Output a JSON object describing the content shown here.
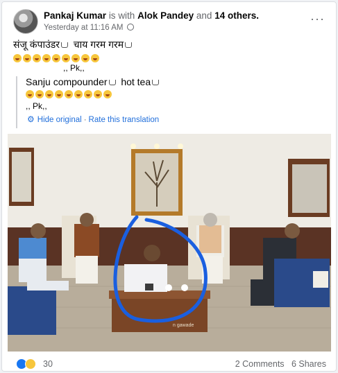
{
  "post": {
    "author": "Pankaj Kumar",
    "is_with": "is with",
    "tagged": "Alok Pandey",
    "and": "and",
    "others": "14 others.",
    "time": "Yesterday at 11:16 AM",
    "more": "···",
    "line1_a": "संजू कंपाउंडर",
    "line1_b": "चाय गरम गरम",
    "sig1": ",, Pk,,"
  },
  "translation": {
    "line1_a": "Sanju compounder",
    "line1_b": "hot tea",
    "sig": ",, Pk,,",
    "hide": "Hide original",
    "sep": "·",
    "rate": "Rate this translation"
  },
  "photo": {
    "plaque_text": "n gawade"
  },
  "footer": {
    "reactions": "30",
    "comments": "2 Comments",
    "shares": "6 Shares"
  },
  "colors": {
    "link": "#216fdb",
    "muted": "#65676b",
    "ink_circle": "#1a5fe0"
  },
  "icons": [
    "avatar",
    "globe-icon",
    "more-icon",
    "cup-icon",
    "laugh-emoji",
    "gear-icon",
    "like-reaction-icon",
    "haha-reaction-icon"
  ]
}
